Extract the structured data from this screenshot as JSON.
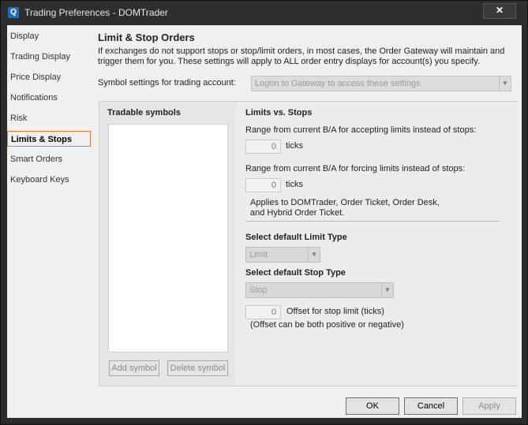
{
  "window": {
    "title": "Trading Preferences - DOMTrader",
    "app_icon_glyph": "Q",
    "close_glyph": "✕"
  },
  "nav": {
    "items": [
      {
        "label": "Display"
      },
      {
        "label": "Trading Display"
      },
      {
        "label": "Price Display"
      },
      {
        "label": "Notifications"
      },
      {
        "label": "Risk"
      },
      {
        "label": "Limits & Stops"
      },
      {
        "label": "Smart Orders"
      },
      {
        "label": "Keyboard Keys"
      }
    ],
    "selected": "Limits & Stops"
  },
  "header": {
    "title": "Limit & Stop Orders",
    "description": "If exchanges do not support stops or stop/limit orders, in most cases, the Order Gateway will maintain and trigger them for you. These settings will apply to ALL order entry displays for account(s) you specify.",
    "account_label": "Symbol settings for trading account:",
    "account_value": "Logon to Gateway to access these settings"
  },
  "symbols": {
    "title": "Tradable symbols",
    "add_label": "Add symbol",
    "delete_label": "Delete symbol"
  },
  "limits": {
    "title": "Limits vs. Stops",
    "accept_label": "Range from current B/A for accepting limits instead of stops:",
    "accept_value": "0",
    "accept_unit": "ticks",
    "force_label": "Range from current B/A for forcing limits instead of stops:",
    "force_value": "0",
    "force_unit": "ticks",
    "applies_line1": "Applies to DOMTrader, Order Ticket, Order Desk,",
    "applies_line2": "and Hybrid Order Ticket."
  },
  "limit_type": {
    "title": "Select default Limit Type",
    "value": "Limit"
  },
  "stop_type": {
    "title": "Select default Stop Type",
    "value": "Stop",
    "offset_value": "0",
    "offset_label": "Offset for stop limit (ticks)",
    "offset_note": "(Offset can be both positive or negative)"
  },
  "footer": {
    "ok_label": "OK",
    "cancel_label": "Cancel",
    "apply_label": "Apply"
  },
  "colors": {
    "selection_border": "#e8743b",
    "title_bar": "#2e2e2e"
  }
}
